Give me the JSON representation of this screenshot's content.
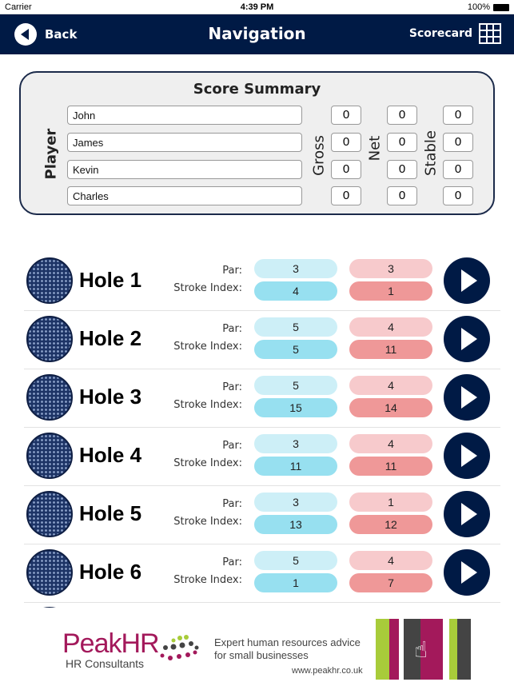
{
  "status": {
    "carrier": "Carrier",
    "time": "4:39 PM",
    "battery": "100%"
  },
  "nav": {
    "back": "Back",
    "title": "Navigation",
    "scorecard": "Scorecard"
  },
  "summary": {
    "title": "Score Summary",
    "player_label": "Player",
    "gross_label": "Gross",
    "net_label": "Net",
    "stable_label": "Stable",
    "players": [
      {
        "name": "John",
        "gross": "0",
        "net": "0",
        "stable": "0"
      },
      {
        "name": "James",
        "gross": "0",
        "net": "0",
        "stable": "0"
      },
      {
        "name": "Kevin",
        "gross": "0",
        "net": "0",
        "stable": "0"
      },
      {
        "name": "Charles",
        "gross": "0",
        "net": "0",
        "stable": "0"
      }
    ]
  },
  "holes": {
    "par_label": "Par:",
    "si_label": "Stroke Index:",
    "items": [
      {
        "name": "Hole 1",
        "par_a": "3",
        "si_a": "4",
        "par_b": "3",
        "si_b": "1"
      },
      {
        "name": "Hole 2",
        "par_a": "5",
        "si_a": "5",
        "par_b": "4",
        "si_b": "11"
      },
      {
        "name": "Hole 3",
        "par_a": "5",
        "si_a": "15",
        "par_b": "4",
        "si_b": "14"
      },
      {
        "name": "Hole 4",
        "par_a": "3",
        "si_a": "11",
        "par_b": "4",
        "si_b": "11"
      },
      {
        "name": "Hole 5",
        "par_a": "3",
        "si_a": "13",
        "par_b": "1",
        "si_b": "12"
      },
      {
        "name": "Hole 6",
        "par_a": "5",
        "si_a": "1",
        "par_b": "4",
        "si_b": "7"
      }
    ]
  },
  "ad": {
    "brand": "PeakHR",
    "sub": "HR Consultants",
    "tagline1": "Expert human resources advice",
    "tagline2": "for small businesses",
    "url": "www.peakhr.co.uk"
  },
  "colors": {
    "navy": "#001a45",
    "par_blue": "#cdeff7",
    "si_blue": "#97e0f0",
    "par_red": "#f7cacc",
    "si_red": "#ef9898",
    "brand_magenta": "#a3195b",
    "brand_green": "#a8cc3a"
  }
}
